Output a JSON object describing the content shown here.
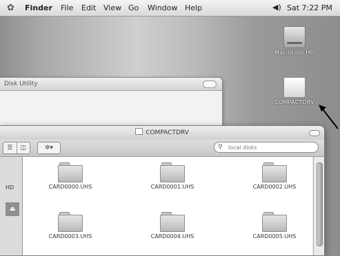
{
  "menubar": {
    "app_name": "Finder",
    "items": [
      "File",
      "Edit",
      "View",
      "Go",
      "Window",
      "Help"
    ],
    "volume_icon": "speaker-icon",
    "clock": "Sat 7:22 PM"
  },
  "desktop": {
    "icons": [
      {
        "label": "Macintosh HD",
        "icon": "hard-drive-icon"
      },
      {
        "label": "COMPACTDRV",
        "icon": "removable-drive-icon"
      }
    ]
  },
  "disk_utility": {
    "title": "Disk Utility"
  },
  "finder_window": {
    "title": "COMPACTDRV",
    "search_placeholder": "local disks",
    "sidebar_items": [
      {
        "label": "HD"
      }
    ],
    "files": [
      {
        "name": "CARD0000.UHS"
      },
      {
        "name": "CARD0001.UHS"
      },
      {
        "name": "CARD0002.UHS"
      },
      {
        "name": "CARD0003.UHS"
      },
      {
        "name": "CARD0004.UHS"
      },
      {
        "name": "CARD0005.UHS"
      }
    ]
  }
}
